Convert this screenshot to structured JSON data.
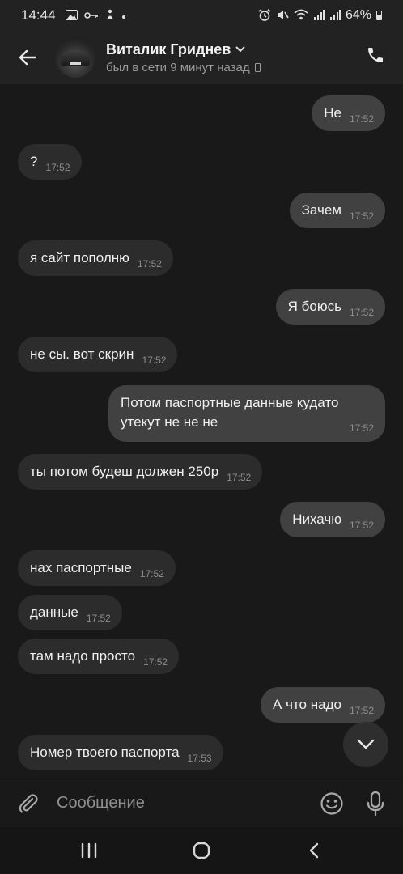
{
  "status_bar": {
    "time": "14:44",
    "battery_percent": "64%"
  },
  "header": {
    "contact_name": "Виталик Гриднев",
    "last_seen": "был в сети 9 минут назад"
  },
  "messages": [
    {
      "direction": "out",
      "text": "Не",
      "time": "17:52"
    },
    {
      "direction": "in",
      "text": "?",
      "time": "17:52"
    },
    {
      "direction": "out",
      "text": "Зачем",
      "time": "17:52"
    },
    {
      "direction": "in",
      "text": "я сайт пополню",
      "time": "17:52"
    },
    {
      "direction": "out",
      "text": "Я боюсь",
      "time": "17:52"
    },
    {
      "direction": "in",
      "text": "не сы. вот скрин",
      "time": "17:52"
    },
    {
      "direction": "out",
      "text": "Потом паспортные данные кудато\nутекут не не не",
      "time": "17:52"
    },
    {
      "direction": "in",
      "text": "ты потом будеш должен 250р",
      "time": "17:52"
    },
    {
      "direction": "out",
      "text": "Нихачю",
      "time": "17:52"
    },
    {
      "direction": "in",
      "text": "нах паспортные",
      "time": "17:52"
    },
    {
      "direction": "in",
      "text": "данные",
      "time": "17:52"
    },
    {
      "direction": "in",
      "text": "там надо просто",
      "time": "17:52"
    },
    {
      "direction": "out",
      "text": "А что надо",
      "time": "17:52"
    },
    {
      "direction": "in",
      "text": "Номер твоего паспорта",
      "time": "17:53"
    }
  ],
  "composer": {
    "placeholder": "Сообщение"
  },
  "icons": {
    "back": "arrow-left-icon",
    "call": "phone-icon",
    "attach": "paperclip-icon",
    "emoji": "smile-icon",
    "mic": "microphone-icon",
    "scroll_down": "chevron-down-icon",
    "nav_recents": "recents-icon",
    "nav_home": "home-icon",
    "nav_back": "nav-back-icon"
  },
  "colors": {
    "background": "#191919",
    "bar": "#222222",
    "incoming_bubble": "#2c2c2c",
    "outgoing_bubble": "#414141"
  }
}
